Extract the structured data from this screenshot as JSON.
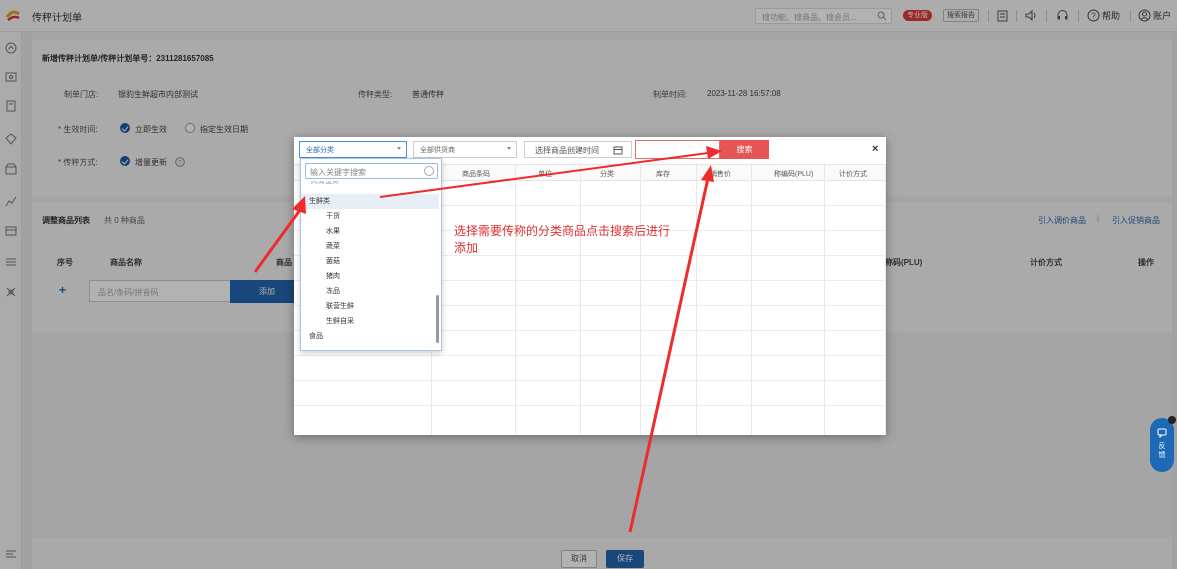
{
  "topbar": {
    "title": "传秤计划单",
    "search_placeholder": "搜功能、搜商品、搜会员...",
    "badge_pro": "专业版",
    "badge_report": "搜索报告",
    "help": "帮助",
    "account": "账户"
  },
  "form": {
    "heading": "新增传秤计划单/传秤计划单号：2311281657085",
    "store_label": "制单门店:",
    "store_value": "银豹生鲜超市内部测试",
    "type_label": "传秤类型:",
    "type_value": "普通传秤",
    "time_label": "制单时间:",
    "time_value": "2023-11-28 16:57:08",
    "effect_label": "* 生效时间:",
    "effect_now": "立即生效",
    "effect_date": "指定生效日期",
    "mode_label": "* 传秤方式:",
    "mode_incremental": "增量更新"
  },
  "adjust": {
    "title": "调整商品列表",
    "count": "共 0 种商品",
    "link_price": "引入调价商品",
    "link_promo": "引入促销商品",
    "col_no": "序号",
    "col_name": "商品名称",
    "col_code_partial": "商品",
    "col_plu_partial": "称码(PLU)",
    "col_pricing": "计价方式",
    "col_action": "操作",
    "input_placeholder": "品名/条码/拼音码",
    "add_button": "添加"
  },
  "footer": {
    "cancel": "取消",
    "save": "保存"
  },
  "modal": {
    "category_select": "全部分类",
    "supplier_select": "全部供货商",
    "date_button": "选择商品创建时间",
    "search_button": "搜索",
    "close": "×",
    "columns": [
      "商品条码",
      "单位",
      "分类",
      "库存",
      "销售价",
      "称编码(PLU)",
      "计价方式"
    ]
  },
  "dropdown": {
    "search_placeholder": "输入关键字搜索",
    "partial_top": "肉禽蛋类",
    "items": [
      {
        "label": "生鲜类",
        "level": 0,
        "highlight": true
      },
      {
        "label": "干货",
        "level": 1
      },
      {
        "label": "水果",
        "level": 1
      },
      {
        "label": "蔬菜",
        "level": 1
      },
      {
        "label": "菌菇",
        "level": 1
      },
      {
        "label": "猪肉",
        "level": 1
      },
      {
        "label": "冻品",
        "level": 1
      },
      {
        "label": "联营生鲜",
        "level": 1
      },
      {
        "label": "生鲜自采",
        "level": 1
      },
      {
        "label": "食品",
        "level": 0
      }
    ]
  },
  "annotation": {
    "line1": "选择需要传称的分类商品点击搜索后进行",
    "line2": "添加"
  },
  "feedback": {
    "label": "反馈"
  },
  "colors": {
    "primary": "#2266b0",
    "danger": "#e55555",
    "annotation": "#e03030"
  }
}
